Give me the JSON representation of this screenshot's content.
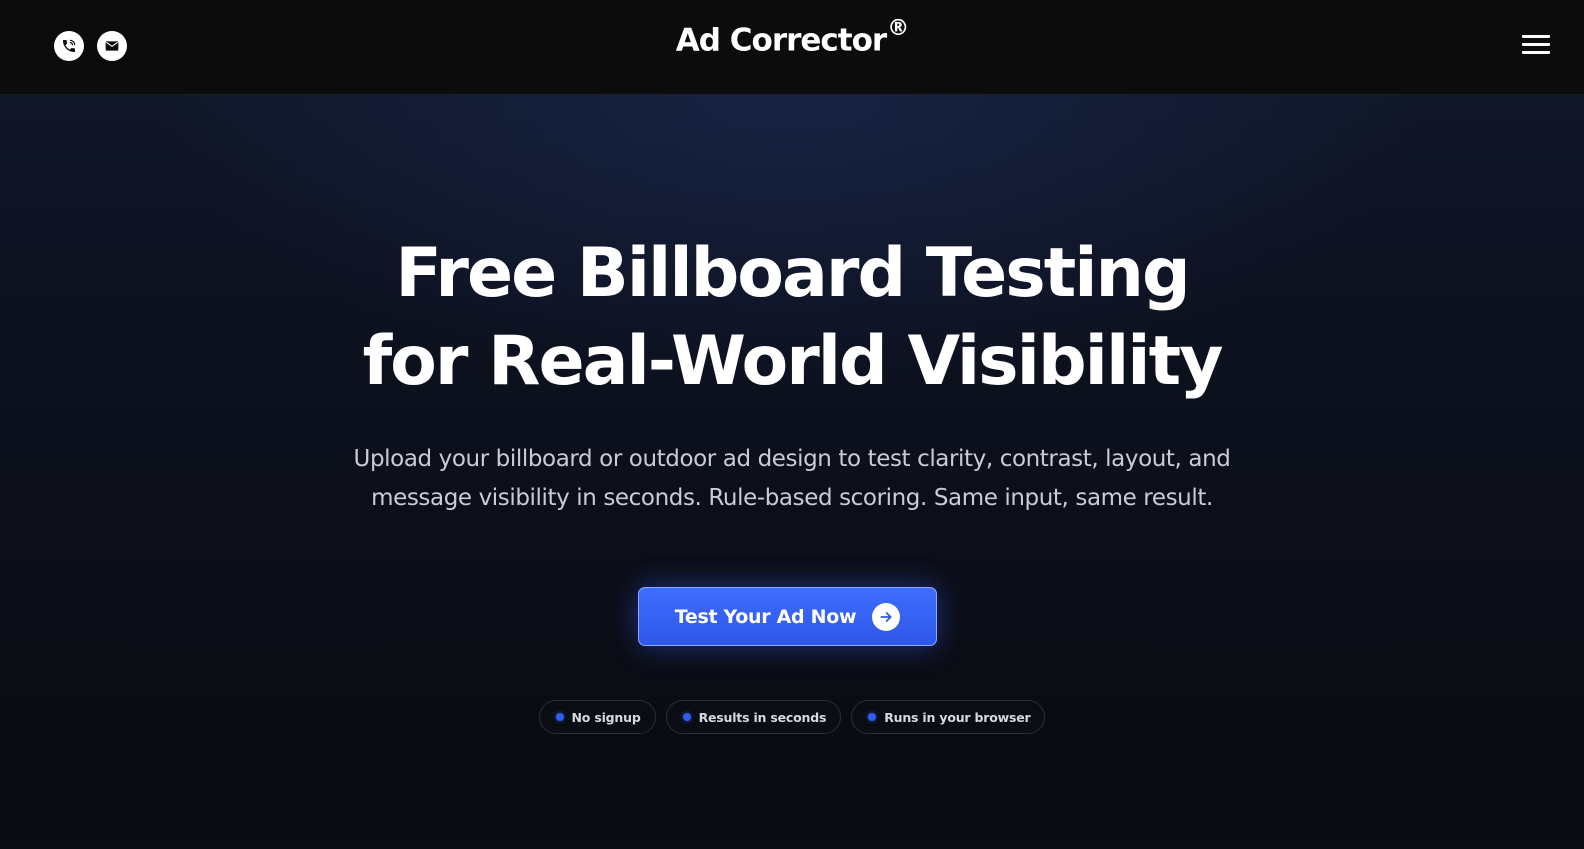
{
  "header": {
    "brand_name": "Ad Corrector",
    "brand_mark": "®",
    "contact_icons": [
      "phone-icon",
      "mail-icon"
    ],
    "menu_icon": "hamburger-menu-icon"
  },
  "hero": {
    "title_line_1": "Free Billboard Testing",
    "title_line_2": "for Real-World Visibility",
    "subtitle_line_1": "Upload your billboard or outdoor ad design to test clarity, contrast, layout, and",
    "subtitle_line_2": "message visibility in seconds. Rule-based scoring. Same input, same result.",
    "cta_label": "Test Your Ad Now",
    "cta_icon": "arrow-right-icon"
  },
  "badges": [
    {
      "label": "No signup"
    },
    {
      "label": "Results in seconds"
    },
    {
      "label": "Runs in your browser"
    }
  ],
  "colors": {
    "accent": "#3561f5",
    "header_bg": "#0c0c0d",
    "hero_bg_top": "#101729",
    "hero_bg_bottom": "#0a0b11",
    "badge_dot": "#2f5df0"
  }
}
